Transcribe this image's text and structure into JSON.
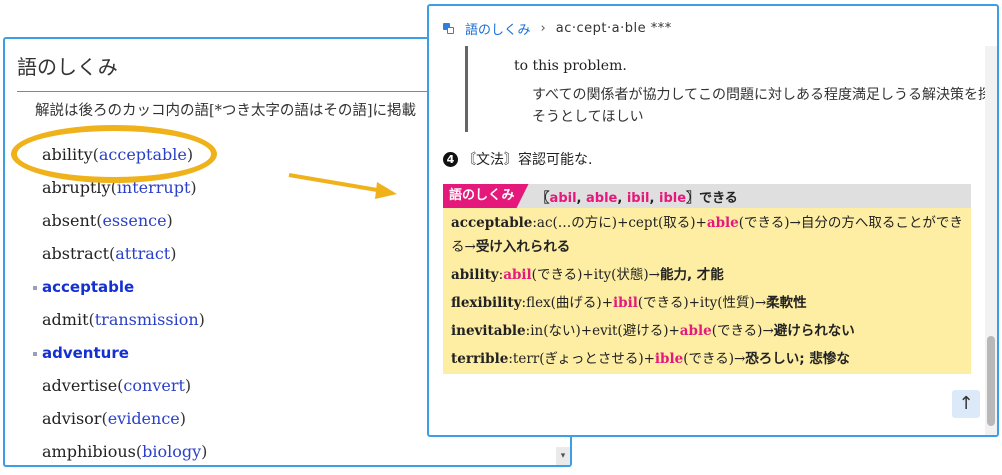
{
  "left_panel": {
    "title": "語のしくみ",
    "description": "解説は後ろのカッコ内の語[*つき太字の語はその語]に掲載",
    "scroll_arrow": "▾",
    "items": [
      {
        "word": "ability",
        "ref": "acceptable",
        "head": false
      },
      {
        "word": "abruptly",
        "ref": "interrupt",
        "head": false
      },
      {
        "word": "absent",
        "ref": "essence",
        "head": false
      },
      {
        "word": "abstract",
        "ref": "attract",
        "head": false
      },
      {
        "word": "acceptable",
        "ref": "",
        "head": true
      },
      {
        "word": "admit",
        "ref": "transmission",
        "head": false
      },
      {
        "word": "adventure",
        "ref": "",
        "head": true
      },
      {
        "word": "advertise",
        "ref": "convert",
        "head": false
      },
      {
        "word": "advisor",
        "ref": "evidence",
        "head": false
      },
      {
        "word": "amphibious",
        "ref": "biology",
        "head": false
      }
    ]
  },
  "right_panel": {
    "breadcrumb": {
      "link": "語のしくみ",
      "separator": "›",
      "current": "ac·cept·a·ble ***"
    },
    "example": {
      "en_tail": "to this problem.",
      "ja": "すべての関係者が協力してこの問題に対しある程度満足しうる解決策を探そうとしてほしい"
    },
    "sense": {
      "number": "4",
      "text": "〘文法〙容認可能な."
    },
    "box": {
      "tag": "語のしくみ",
      "roots_open": "〖",
      "roots": [
        "abil",
        "able",
        "ibil",
        "ible"
      ],
      "roots_close": "〗",
      "roots_meaning": "できる",
      "entries": [
        {
          "key": "acceptable",
          "parts": [
            "ac(…の方に)+cept(取る)+",
            "able",
            "(できる)→自分の方へ取ることができる→"
          ],
          "result": "受け入れられる"
        },
        {
          "key": "ability",
          "parts": [
            "",
            "abil",
            "(できる)+ity(状態)→"
          ],
          "result": "能力, 才能"
        },
        {
          "key": "flexibility",
          "parts": [
            "flex(曲げる)+",
            "ibil",
            "(できる)+ity(性質)→"
          ],
          "result": "柔軟性"
        },
        {
          "key": "inevitable",
          "parts": [
            "in(ない)+evit(避ける)+",
            "able",
            "(できる)→"
          ],
          "result": "避けられない"
        },
        {
          "key": "terrible",
          "parts": [
            "terr(ぎょっとさせる)+",
            "ible",
            "(できる)→"
          ],
          "result": "恐ろしい; 悲惨な"
        }
      ]
    },
    "up_button": "↑"
  },
  "colors": {
    "accent_blue": "#3d9ee8",
    "link_blue": "#2a40c8",
    "magenta": "#e4197b",
    "box_yellow": "#fdeea4",
    "highlight_orange": "#f0b21b"
  }
}
